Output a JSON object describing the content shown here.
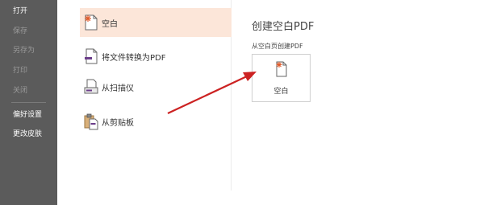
{
  "sidebar": {
    "items": [
      {
        "label": "打开"
      },
      {
        "label": "保存"
      },
      {
        "label": "另存为"
      },
      {
        "label": "打印"
      },
      {
        "label": "关闭"
      },
      {
        "label": "偏好设置"
      },
      {
        "label": "更改皮肤"
      }
    ]
  },
  "options": [
    {
      "label": "空白",
      "icon": "blank-page-icon"
    },
    {
      "label": "将文件转换为PDF",
      "icon": "file-convert-icon"
    },
    {
      "label": "从扫描仪",
      "icon": "scanner-icon"
    },
    {
      "label": "从剪贴板",
      "icon": "clipboard-icon"
    }
  ],
  "create": {
    "title": "创建空白PDF",
    "subtitle": "从空白页创建PDF",
    "card_label": "空白"
  },
  "colors": {
    "sidebar_bg": "#5b5b5b",
    "selected_bg": "#fce6d9",
    "arrow": "#cc2222",
    "accent": "#e05a2a"
  }
}
